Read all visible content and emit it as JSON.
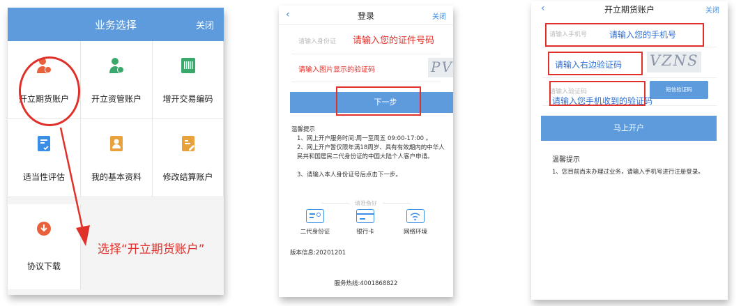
{
  "screen1": {
    "title": "业务选择",
    "close": "关闭",
    "items": [
      {
        "label": "开立期货账户",
        "icon": "person-fund-icon",
        "color": "#e8603c"
      },
      {
        "label": "开立资管账户",
        "icon": "person-money-icon",
        "color": "#3aa86b"
      },
      {
        "label": "增开交易编码",
        "icon": "barcode-icon",
        "color": "#3aa86b"
      },
      {
        "label": "适当性评估",
        "icon": "checklist-icon",
        "color": "#3a8ee6"
      },
      {
        "label": "我的基本资料",
        "icon": "profile-card-icon",
        "color": "#e8a23c"
      },
      {
        "label": "修改结算账户",
        "icon": "edit-account-icon",
        "color": "#e8a23c"
      },
      {
        "label": "协议下载",
        "icon": "download-icon",
        "color": "#e8603c"
      }
    ],
    "annotation": "选择“开立期货账户”"
  },
  "screen2": {
    "back": "‹",
    "title": "登录",
    "close": "关闭",
    "id_placeholder": "请输入身份证",
    "id_hint": "请输入您的证件号码",
    "captcha_hint": "请输入图片显示的验证码",
    "captcha_text": "PVES",
    "next_button": "下一步",
    "tips_title": "温馨提示",
    "tips": [
      "1、网上开户服务时间:周一至周五 09:00-17:00 。",
      "2、网上开户暂仅限年满18周岁、具有有效期内的中华人民共和国居民二代身份证的中国大陆个人客户申请。",
      "3、请输入本人身份证号后点击下一步。"
    ],
    "ready_label": "请准备好",
    "ready_items": [
      {
        "label": "二代身份证",
        "icon": "id-card-icon"
      },
      {
        "label": "银行卡",
        "icon": "bank-card-icon"
      },
      {
        "label": "网络环境",
        "icon": "wifi-icon"
      }
    ],
    "version": "版本信息:20201201",
    "hotline": "服务热线:4001868822"
  },
  "screen3": {
    "back": "‹",
    "title": "开立期货账户",
    "close": "关闭",
    "phone_placeholder": "请输入手机号",
    "phone_hint": "请输入您的手机号",
    "captcha_hint": "请输入右边验证码",
    "captcha_text": "VZNS",
    "sms_placeholder": "请输入验证码",
    "sms_button": "短信验证码",
    "sms_hint": "请输入您手机收到的验证码",
    "open_button": "马上开户",
    "tips_title": "温馨提示",
    "tips": "1、您目前尚未办理过业务，请输入手机号进行注册登录。"
  },
  "colors": {
    "accent_blue": "#5e9bdc",
    "annotation_red": "#e0302a",
    "hint_blue": "#2f6fd6"
  }
}
